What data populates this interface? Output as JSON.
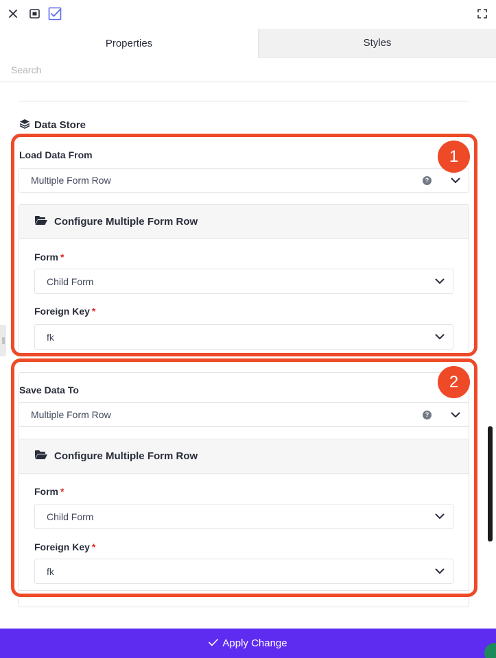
{
  "toolbar": {
    "icons": [
      "close-icon",
      "embed-icon",
      "checkbox-icon",
      "fullscreen-icon"
    ]
  },
  "tabs": [
    {
      "label": "Properties",
      "active": true
    },
    {
      "label": "Styles",
      "active": false
    }
  ],
  "search": {
    "placeholder": "Search",
    "value": ""
  },
  "data_store": {
    "title": "Data Store",
    "icon": "layers-icon",
    "load": {
      "badge": "1",
      "label": "Load Data From",
      "value": "Multiple Form Row",
      "config": {
        "title": "Configure Multiple Form Row",
        "icon": "folder-open-icon",
        "form_label": "Form",
        "form_required": "*",
        "form_value": "Child Form",
        "fk_label": "Foreign Key",
        "fk_required": "*",
        "fk_value": "fk"
      }
    },
    "save": {
      "badge": "2",
      "label": "Save Data To",
      "value": "Multiple Form Row",
      "config": {
        "title": "Configure Multiple Form Row",
        "icon": "folder-open-icon",
        "form_label": "Form",
        "form_required": "*",
        "form_value": "Child Form",
        "fk_label": "Foreign Key",
        "fk_required": "*",
        "fk_value": "fk"
      }
    }
  },
  "help_glyph": "?",
  "footer": {
    "apply_label": "Apply Change",
    "apply_icon": "check-icon"
  },
  "colors": {
    "accent": "#5e2cf1",
    "highlight": "#ee4a28",
    "required": "#e02b2b",
    "checkbox_icon": "#5b6cf0"
  }
}
